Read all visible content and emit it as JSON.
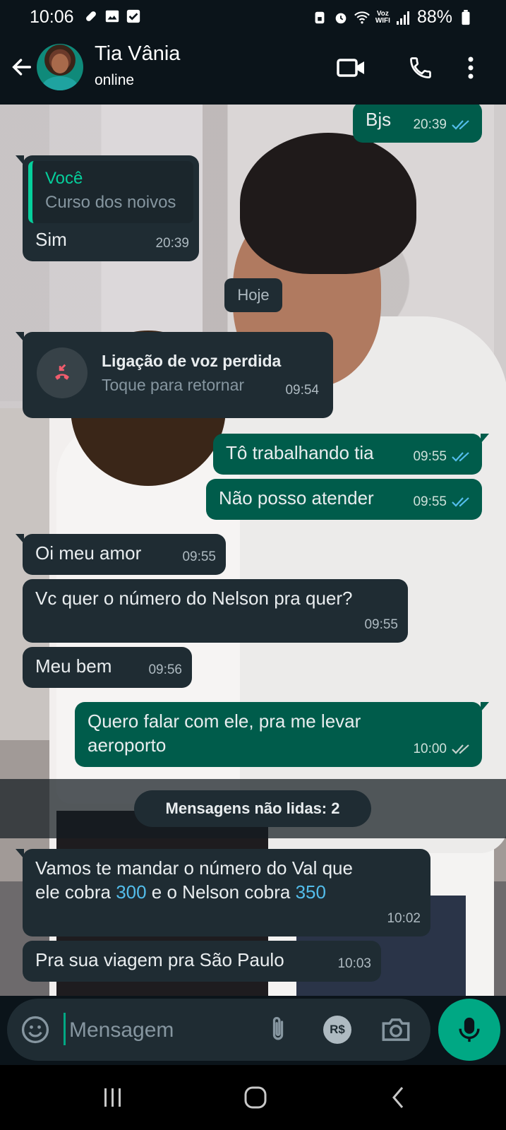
{
  "status_bar": {
    "time": "10:06",
    "volte_top": "Voz",
    "volte_bottom": "WIFI",
    "battery": "88%"
  },
  "header": {
    "contact_name": "Tia Vânia",
    "contact_status": "online"
  },
  "messages": {
    "m1": {
      "text": "Bjs",
      "time": "20:39"
    },
    "m2": {
      "quote_author": "Você",
      "quote_text": "Curso dos noivos",
      "text": "Sim",
      "time": "20:39"
    },
    "day": "Hoje",
    "call": {
      "title": "Ligação de voz perdida",
      "subtitle": "Toque para retornar",
      "time": "09:54"
    },
    "m3": {
      "text": "Tô trabalhando tia",
      "time": "09:55"
    },
    "m4": {
      "text": "Não posso atender",
      "time": "09:55"
    },
    "m5": {
      "text": "Oi meu amor",
      "time": "09:55"
    },
    "m6": {
      "text": "Vc quer o número do Nelson pra quer?",
      "time": "09:55"
    },
    "m7": {
      "text": "Meu bem",
      "time": "09:56"
    },
    "m8": {
      "line1": "Quero falar com ele, pra me levar",
      "line2": "aeroporto",
      "time": "10:00"
    },
    "unread": "Mensagens não lidas: 2",
    "m9": {
      "part1": "Vamos te mandar o número do Val que",
      "part2": "ele cobra ",
      "num1": "300",
      "part3": " e o Nelson cobra ",
      "num2": "350",
      "time": "10:02"
    },
    "m10": {
      "text": "Pra sua viagem pra São Paulo",
      "time": "10:03"
    }
  },
  "composer": {
    "placeholder": "Mensagem",
    "pay_label": "R$"
  },
  "colors": {
    "incoming": "#1f2c33",
    "outgoing": "#005c4b",
    "accent": "#00a884",
    "read_ticks": "#53bdeb",
    "missed_call": "#f15c6d"
  }
}
